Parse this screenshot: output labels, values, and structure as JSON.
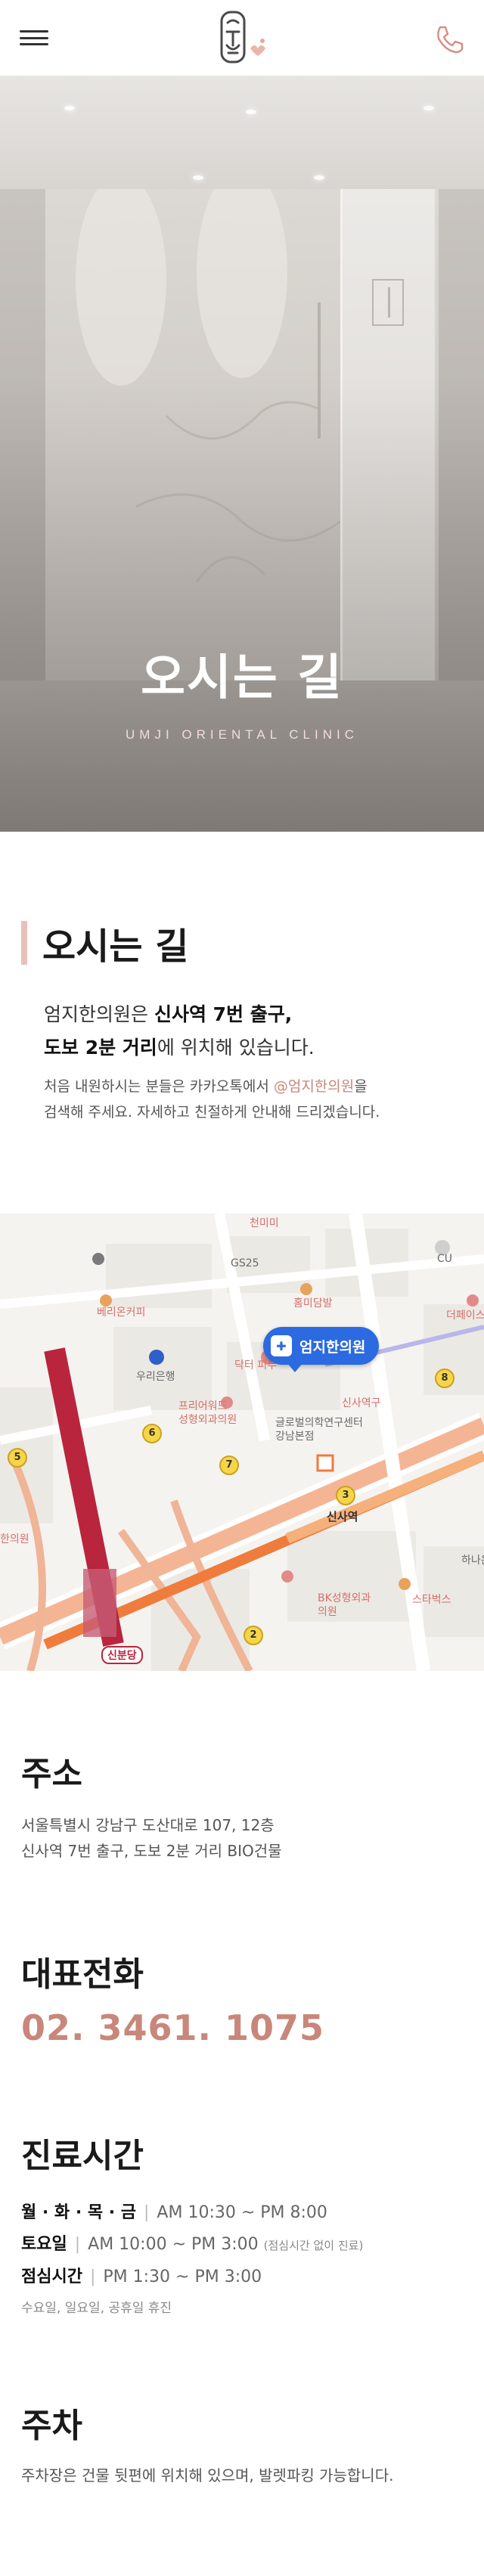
{
  "header": {
    "menu_icon": "hamburger-menu-icon",
    "logo_icon": "umji-seal-logo",
    "phone_icon": "phone-icon"
  },
  "hero": {
    "title": "오시는 길",
    "subtitle": "UMJI ORIENTAL CLINIC"
  },
  "directions": {
    "title": "오시는 길",
    "line1_prefix": "엄지한의원은 ",
    "line1_strong": "신사역 7번 출구,",
    "line2_strong": "도보 2분 거리",
    "line2_suffix": "에 위치해 있습니다.",
    "note1_prefix": "처음 내원하시는 분들은 카카오톡에서 ",
    "note1_link": "@엄지한의원",
    "note1_suffix": "을",
    "note2": "검색해 주세요. 자세하고 친절하게 안내해 드리겠습니다."
  },
  "map": {
    "pin_label": "엄지한의원",
    "labels": {
      "cheonmi": "천미미",
      "gs25": "GS25",
      "cu": "CU",
      "berry": "베리온커피",
      "hommi": "홈미담발",
      "theface": "더페이스",
      "woori": "우리은행",
      "freeaward": "프리어워드\n성형외과의원",
      "sinsa_stn": "신사역",
      "global": "글로벌의학연구센터\n강남본점",
      "hana": "하나은",
      "bk": "BK성형외과\n의원",
      "starbucks": "스타벅스",
      "sinbundang": "신분당",
      "sinsa_clinic": "신사역구",
      "dakter": "닥터\n피부",
      "hanil": "한의원"
    },
    "exits": [
      "8",
      "6",
      "7",
      "3",
      "5",
      "2"
    ]
  },
  "address": {
    "title": "주소",
    "line1": "서울특별시 강남구 도산대로 107, 12층",
    "line2": "신사역 7번 출구, 도보 2분 거리 BIO건물"
  },
  "phone": {
    "title": "대표전화",
    "number": "02. 3461. 1075"
  },
  "hours": {
    "title": "진료시간",
    "rows": [
      {
        "day": "월 · 화 · 목 · 금",
        "time": "AM 10:30 ~ PM 8:00",
        "note": ""
      },
      {
        "day": "토요일",
        "time": "AM 10:00 ~ PM 3:00",
        "note": "(점심시간 없이 진료)"
      },
      {
        "day": "점심시간",
        "time": "PM 1:30 ~ PM 3:00",
        "note": ""
      }
    ],
    "closed": "수요일, 일요일, 공휴일 휴진"
  },
  "parking": {
    "title": "주차",
    "text": "주차장은 건물 뒷편에 위치해 있으며, 발렛파킹 가능합니다."
  },
  "colors": {
    "accent": "#c8877a",
    "title_bar": "#e6c2bb",
    "map_pin": "#2b6ae0",
    "subway_line": "#e8845d",
    "shinbundang_line": "#b8253d"
  }
}
